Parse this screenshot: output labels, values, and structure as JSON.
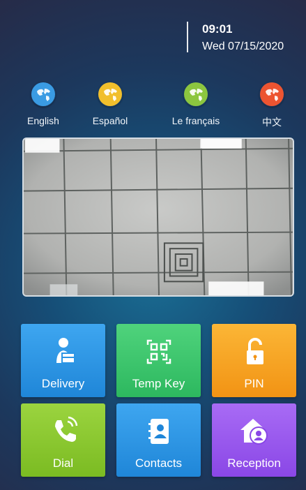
{
  "status": {
    "time": "09:01",
    "date": "Wed 07/15/2020"
  },
  "languages": [
    {
      "label": "English",
      "color": "#3a9be3"
    },
    {
      "label": "Español",
      "color": "#f1bf2c"
    },
    {
      "label": "Le français",
      "color": "#8cc63f"
    },
    {
      "label": "中文",
      "color": "#ec5431"
    }
  ],
  "camera": {
    "icon": "camera-preview"
  },
  "tiles": [
    {
      "label": "Delivery",
      "icon": "delivery-person-icon",
      "color": "#2a95e6"
    },
    {
      "label": "Temp Key",
      "icon": "qr-code-icon",
      "color": "#3fc66f"
    },
    {
      "label": "PIN",
      "icon": "unlock-icon",
      "color": "#f7a421"
    },
    {
      "label": "Dial",
      "icon": "phone-icon",
      "color": "#8cc836"
    },
    {
      "label": "Contacts",
      "icon": "contacts-book-icon",
      "color": "#2a95e6"
    },
    {
      "label": "Reception",
      "icon": "reception-house-icon",
      "color": "#9b5bf0"
    }
  ]
}
